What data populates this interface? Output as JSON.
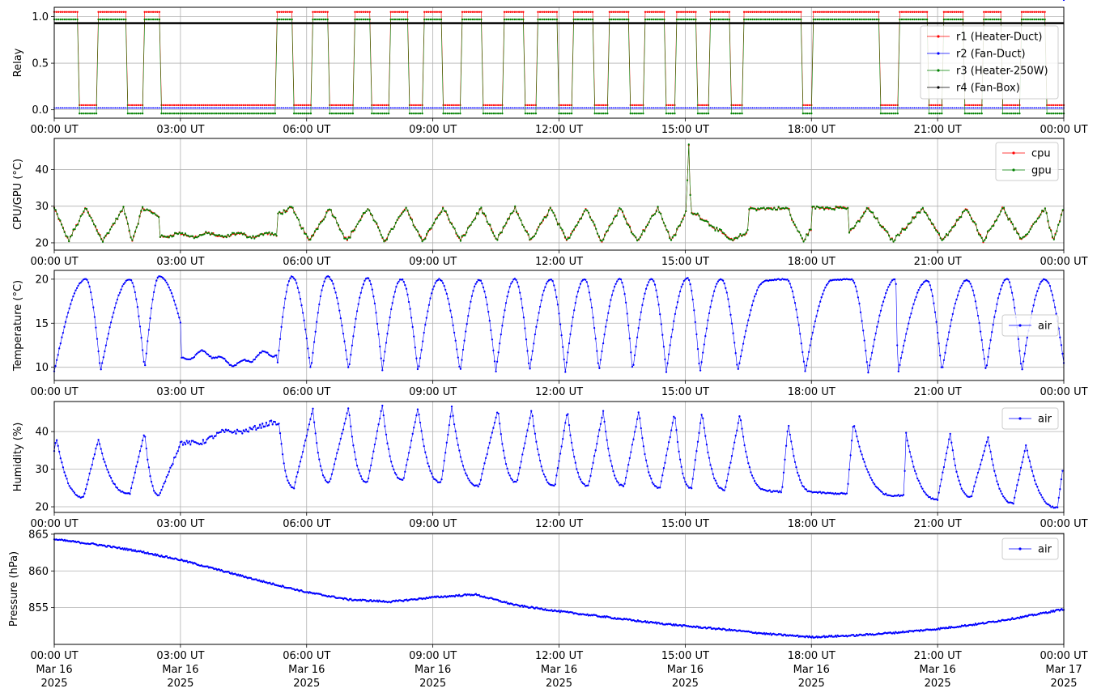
{
  "figure": {
    "x_tick_labels": [
      "00:00 UT",
      "03:00 UT",
      "06:00 UT",
      "09:00 UT",
      "12:00 UT",
      "15:00 UT",
      "18:00 UT",
      "21:00 UT",
      "00:00 UT"
    ],
    "x_date_labels": [
      [
        "Mar 16",
        "2025"
      ],
      [
        "Mar 16",
        "2025"
      ],
      [
        "Mar 16",
        "2025"
      ],
      [
        "Mar 16",
        "2025"
      ],
      [
        "Mar 16",
        "2025"
      ],
      [
        "Mar 16",
        "2025"
      ],
      [
        "Mar 16",
        "2025"
      ],
      [
        "Mar 16",
        "2025"
      ],
      [
        "Mar 17",
        "2025"
      ]
    ],
    "colors": {
      "red": "#ff0000",
      "blue": "#0000ff",
      "green": "#008000",
      "black": "#000000",
      "grid": "#b0b0b0"
    }
  },
  "chart_data": [
    {
      "type": "line",
      "ylabel": "Relay",
      "xlim": [
        "00:00 UT",
        "24:00 UT"
      ],
      "ylim": [
        -0.09,
        1.1
      ],
      "y_ticks": [
        0.0,
        0.5,
        1.0
      ],
      "y_tick_labels": [
        "0.0",
        "0.5",
        "1.0"
      ],
      "grid": true,
      "legend_position": "right",
      "legend": [
        "r1 (Heater-Duct)",
        "r2 (Fan-Duct)",
        "r3 (Heater-250W)",
        "r4 (Fan-Box)"
      ],
      "on_intervals_hours": [
        [
          0.0,
          0.55
        ],
        [
          1.03,
          1.75
        ],
        [
          2.13,
          2.5
        ],
        [
          5.28,
          5.65
        ],
        [
          6.13,
          6.53
        ],
        [
          7.13,
          7.53
        ],
        [
          7.98,
          8.43
        ],
        [
          8.78,
          9.23
        ],
        [
          9.68,
          10.18
        ],
        [
          10.68,
          11.18
        ],
        [
          11.48,
          11.98
        ],
        [
          12.33,
          12.83
        ],
        [
          13.18,
          13.68
        ],
        [
          14.03,
          14.53
        ],
        [
          14.78,
          15.28
        ],
        [
          15.58,
          16.08
        ],
        [
          16.38,
          17.78
        ],
        [
          18.03,
          19.63
        ],
        [
          20.08,
          20.78
        ],
        [
          21.13,
          21.63
        ],
        [
          22.08,
          22.53
        ],
        [
          22.98,
          23.58
        ]
      ],
      "series": [
        {
          "name": "r1 (Heater-Duct)",
          "color": "#ff0000",
          "on_value": 1.05,
          "off_value": 0.05
        },
        {
          "name": "r2 (Fan-Duct)",
          "color": "#0000ff",
          "constant_value": 0.02
        },
        {
          "name": "r3 (Heater-250W)",
          "color": "#008000",
          "on_value": 0.97,
          "off_value": -0.04
        },
        {
          "name": "r4 (Fan-Box)",
          "color": "#000000",
          "constant_value": 0.93
        }
      ]
    },
    {
      "type": "line",
      "ylabel": "CPU/GPU (°C)",
      "xlim": [
        "00:00 UT",
        "24:00 UT"
      ],
      "ylim": [
        18,
        48.5
      ],
      "y_ticks": [
        20,
        30,
        40
      ],
      "y_tick_labels": [
        "20",
        "30",
        "40"
      ],
      "grid": true,
      "legend_position": "top-right",
      "legend": [
        "cpu",
        "gpu"
      ],
      "series": [
        {
          "name": "cpu",
          "color": "#ff0000",
          "range": [
            19.5,
            47.0
          ],
          "peak": {
            "hour": 15.08,
            "value": 47.0
          }
        },
        {
          "name": "gpu",
          "color": "#008000",
          "range": [
            20.0,
            47.0
          ],
          "peak": {
            "hour": 15.08,
            "value": 47.0
          }
        }
      ]
    },
    {
      "type": "line",
      "ylabel": "Temperature (°C)",
      "xlim": [
        "00:00 UT",
        "24:00 UT"
      ],
      "ylim": [
        8.5,
        21
      ],
      "y_ticks": [
        10,
        15,
        20
      ],
      "y_tick_labels": [
        "10",
        "15",
        "20"
      ],
      "grid": true,
      "legend_position": "right",
      "legend": [
        "air"
      ],
      "series": [
        {
          "name": "air",
          "color": "#0000ff",
          "range": [
            9.1,
            20.3
          ],
          "min_point": {
            "hour": 20.05,
            "value": 9.1
          }
        }
      ]
    },
    {
      "type": "line",
      "ylabel": "Humidity (%)",
      "xlim": [
        "00:00 UT",
        "24:00 UT"
      ],
      "ylim": [
        18.5,
        48
      ],
      "y_ticks": [
        20,
        30,
        40
      ],
      "y_tick_labels": [
        "20",
        "30",
        "40"
      ],
      "grid": true,
      "legend_position": "top-right",
      "legend": [
        "air"
      ],
      "series": [
        {
          "name": "air",
          "color": "#0000ff",
          "range": [
            19.8,
            47.0
          ],
          "max_point": {
            "hour": 7.75,
            "value": 47.0
          }
        }
      ]
    },
    {
      "type": "line",
      "ylabel": "Pressure (hPa)",
      "xlim": [
        "00:00 UT",
        "24:00 UT"
      ],
      "ylim": [
        850.0,
        865.1
      ],
      "y_ticks": [
        855,
        860,
        865
      ],
      "y_tick_labels": [
        "855",
        "860",
        "865"
      ],
      "grid": true,
      "legend_position": "top-right",
      "legend": [
        "air"
      ],
      "series": [
        {
          "name": "air",
          "color": "#0000ff",
          "x": [
            0,
            1,
            2,
            3,
            4,
            5,
            6,
            7,
            8,
            9,
            10,
            11,
            12,
            13,
            14,
            15,
            16,
            17,
            18,
            19,
            20,
            21,
            22,
            23,
            24
          ],
          "y": [
            864.3,
            863.6,
            862.7,
            861.5,
            860.0,
            858.5,
            857.1,
            856.1,
            855.8,
            856.4,
            856.8,
            855.3,
            854.5,
            853.8,
            853.1,
            852.5,
            852.0,
            851.4,
            851.0,
            851.2,
            851.6,
            852.1,
            852.8,
            853.7,
            854.8
          ]
        }
      ]
    }
  ]
}
